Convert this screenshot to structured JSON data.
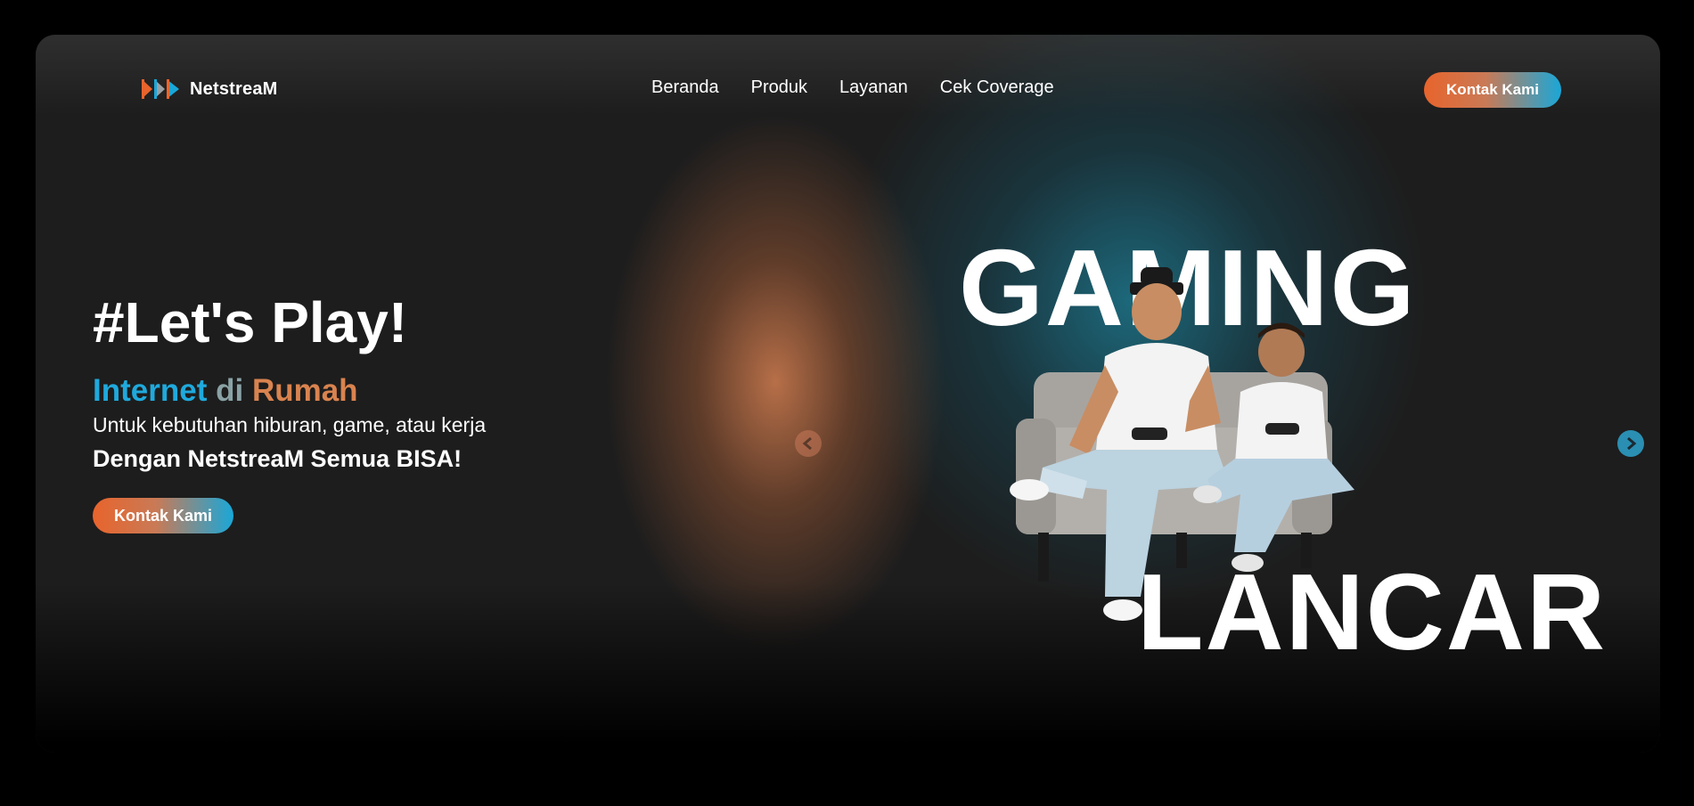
{
  "brand": {
    "name": "NetstreaM"
  },
  "nav": {
    "items": [
      {
        "label": "Beranda"
      },
      {
        "label": "Produk"
      },
      {
        "label": "Layanan"
      },
      {
        "label": "Cek Coverage"
      }
    ],
    "cta_label": "Kontak Kami"
  },
  "hero": {
    "heading": "#Let's Play!",
    "tagline": {
      "part1": "Internet",
      "part2": "di",
      "part3": "Rumah"
    },
    "subtitle": "Untuk kebutuhan hiburan, game, atau kerja",
    "subtitle2": "Dengan NetstreaM Semua BISA!",
    "cta_label": "Kontak Kami",
    "banner_word_top": "GAMING",
    "banner_word_bottom": "LANCAR"
  },
  "carousel": {
    "prev_icon": "chevron-left-icon",
    "next_icon": "chevron-right-icon"
  },
  "colors": {
    "accent_orange": "#e8642c",
    "accent_blue": "#1aa7d8",
    "background": "#1d1d1d"
  }
}
